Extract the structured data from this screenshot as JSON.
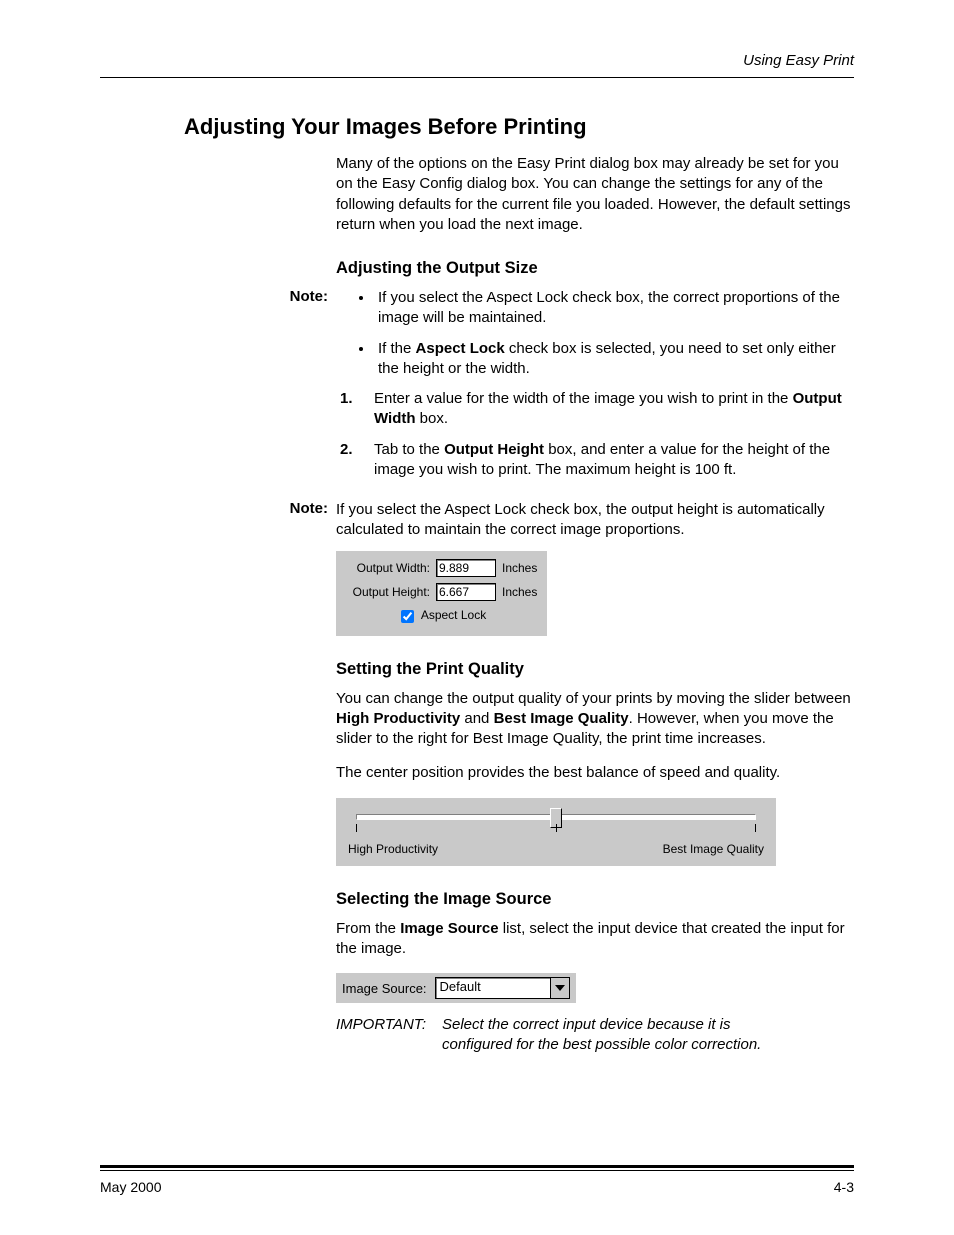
{
  "running_head": "Using Easy Print",
  "title": "Adjusting Your Images Before Printing",
  "intro": "Many of the options on the Easy Print dialog box may already be set for you on the Easy Config dialog box. You can change the settings for any of the following defaults for the current file you loaded. However, the default settings return when you load the next image.",
  "sec_output": {
    "heading": "Adjusting the Output Size",
    "note_label": "Note:",
    "bullets": {
      "b1": "If you select the Aspect Lock check box, the correct proportions of the image will be maintained.",
      "b2a": "If the ",
      "b2b": "Aspect Lock",
      "b2c": " check box is selected, you need to set only either the height or the width."
    },
    "steps": {
      "s1a": "Enter a value for the width of the image you wish to print in the ",
      "s1b": "Output Width",
      "s1c": " box.",
      "s2a": "Tab to the ",
      "s2b": "Output Height",
      "s2c": " box, and enter a value for the height of the image you wish to print. The maximum height is 100 ft."
    },
    "note2_label": "Note:",
    "note2_body": "If you select the Aspect Lock check box, the output height is automatically calculated to maintain the correct image proportions.",
    "ui": {
      "width_label": "Output Width:",
      "width_value": "9.889",
      "height_label": "Output Height:",
      "height_value": "6.667",
      "unit": "Inches",
      "aspect_label": "Aspect Lock",
      "aspect_checked": true
    }
  },
  "sec_quality": {
    "heading": "Setting the Print Quality",
    "p1a": "You can change the output quality of your prints by moving the slider between ",
    "p1b": "High Productivity",
    "p1c": " and ",
    "p1d": "Best Image Quality",
    "p1e": ". However, when you move the slider to the right for Best Image Quality, the print time increases.",
    "p2": "The center position provides the best balance of speed and quality.",
    "slider": {
      "left": "High Productivity",
      "right": "Best Image Quality"
    }
  },
  "sec_source": {
    "heading": "Selecting the Image Source",
    "p1a": "From the ",
    "p1b": "Image Source",
    "p1c": " list, select the input device that created the input for the image.",
    "ui": {
      "label": "Image Source:",
      "value": "Default"
    },
    "important_label": "IMPORTANT:",
    "important_body": "Select the correct input device because it is configured for the best possible color correction."
  },
  "footer": {
    "left": "May 2000",
    "right": "4-3"
  }
}
